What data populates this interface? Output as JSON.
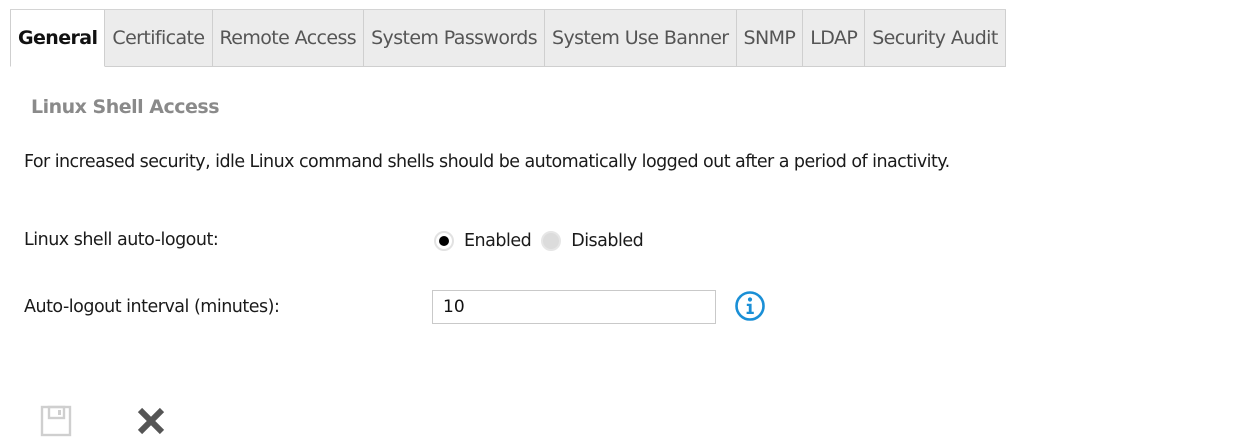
{
  "tabs": [
    {
      "label": "General",
      "active": true
    },
    {
      "label": "Certificate",
      "active": false
    },
    {
      "label": "Remote Access",
      "active": false
    },
    {
      "label": "System Passwords",
      "active": false
    },
    {
      "label": "System Use Banner",
      "active": false
    },
    {
      "label": "SNMP",
      "active": false
    },
    {
      "label": "LDAP",
      "active": false
    },
    {
      "label": "Security Audit",
      "active": false
    }
  ],
  "section": {
    "title": "Linux Shell Access",
    "description": "For increased security, idle Linux command shells should be automatically logged out after a period of inactivity."
  },
  "auto_logout": {
    "label": "Linux shell auto-logout:",
    "options": [
      "Enabled",
      "Disabled"
    ],
    "selected": "Enabled"
  },
  "interval": {
    "label": "Auto-logout interval (minutes):",
    "value": "10"
  },
  "icons": {
    "info": "info-icon",
    "save": "save-icon",
    "cancel": "close-icon"
  },
  "colors": {
    "info_accent": "#1a8fd6",
    "section_title": "#8a8a8a",
    "tab_bg": "#ececec",
    "disabled_icon": "#cfcfcf",
    "cancel_icon": "#555555"
  }
}
